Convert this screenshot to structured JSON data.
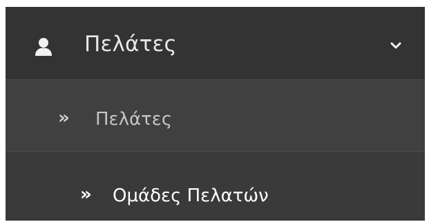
{
  "menu": {
    "header": {
      "icon": "user-icon",
      "label": "Πελάτες",
      "toggle_icon": "chevron-down-icon",
      "expanded": true
    },
    "items": [
      {
        "icon": "double-chevron-right-icon",
        "arrow_glyph": "»",
        "label": "Πελάτες",
        "active": false
      },
      {
        "icon": "double-chevron-right-icon",
        "arrow_glyph": "»",
        "label": "Ομάδες Πελατών",
        "active": true
      }
    ]
  },
  "colors": {
    "header_bg": "#333333",
    "item_bg": "#404040",
    "active_item_bg": "#3a3a3a",
    "text": "#e8e8e8",
    "active_text": "#ffffff"
  }
}
